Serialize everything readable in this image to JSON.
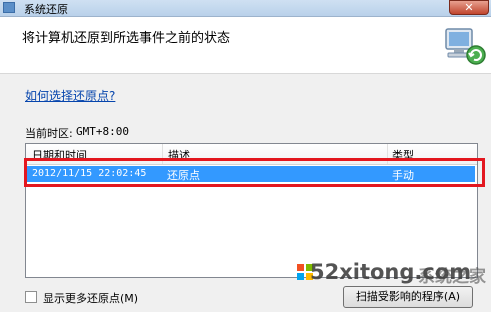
{
  "window": {
    "title": "系统还原",
    "close_label": "✕"
  },
  "header": {
    "title": "将计算机还原到所选事件之前的状态"
  },
  "help_link": "如何选择还原点?",
  "timezone": {
    "label": "当前时区:",
    "value": "GMT+8:00"
  },
  "table": {
    "columns": [
      "日期和时间",
      "描述",
      "类型"
    ],
    "rows": [
      {
        "datetime": "2012/11/15 22:02:45",
        "description": "还原点",
        "type": "手动",
        "selected": true
      }
    ]
  },
  "show_more": {
    "label": "显示更多还原点(M)",
    "checked": false
  },
  "scan_button": {
    "label": "扫描受影响的程序(A)"
  },
  "watermark": {
    "text": "52xitong.com",
    "cn": "系统之家"
  },
  "colors": {
    "selection": "#3399ff",
    "highlight_box": "#e3171f",
    "link": "#0645ad"
  }
}
